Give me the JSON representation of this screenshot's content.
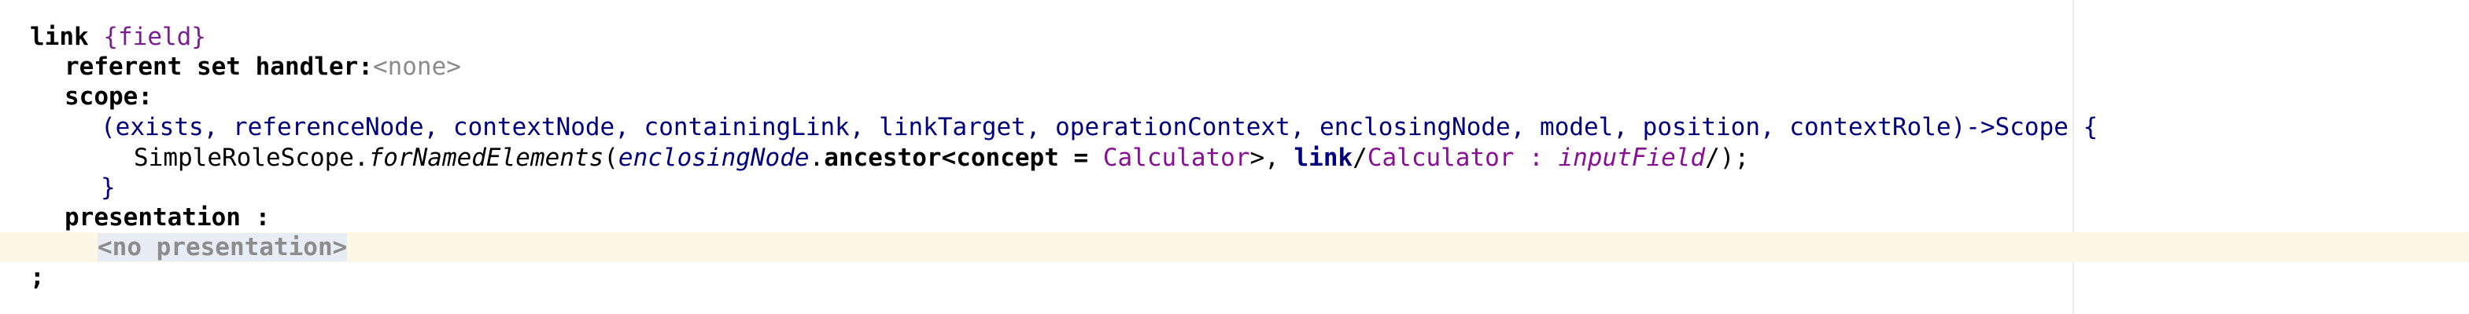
{
  "editor": {
    "line1": {
      "keyword": "link",
      "annotation": "{field}"
    },
    "line2": {
      "label": "referent set handler:",
      "value": "<none>"
    },
    "line3": {
      "label": "scope:"
    },
    "line4": {
      "params": "(exists, referenceNode, contextNode, containingLink, linkTarget, operationContext, enclosingNode, model, position, contextRole)",
      "arrow": "->Scope {"
    },
    "line5": {
      "receiver": "SimpleRoleScope.",
      "method": "forNamedElements",
      "paren_open": "(",
      "param": "enclosingNode",
      "dot": ".",
      "op": "ancestor",
      "lt_concept": "<concept = ",
      "concept": "Calculator",
      "gt_comma": ">, ",
      "link_kw": "link",
      "slash1": "/",
      "link_concept": "Calculator",
      "colon": " : ",
      "link_field": "inputField",
      "slash2": "/",
      "end": ");"
    },
    "line6": {
      "brace": "}"
    },
    "line7": {
      "label": "presentation :"
    },
    "line8": {
      "placeholder": "<no presentation>"
    },
    "line9": {
      "terminator": ";"
    }
  }
}
